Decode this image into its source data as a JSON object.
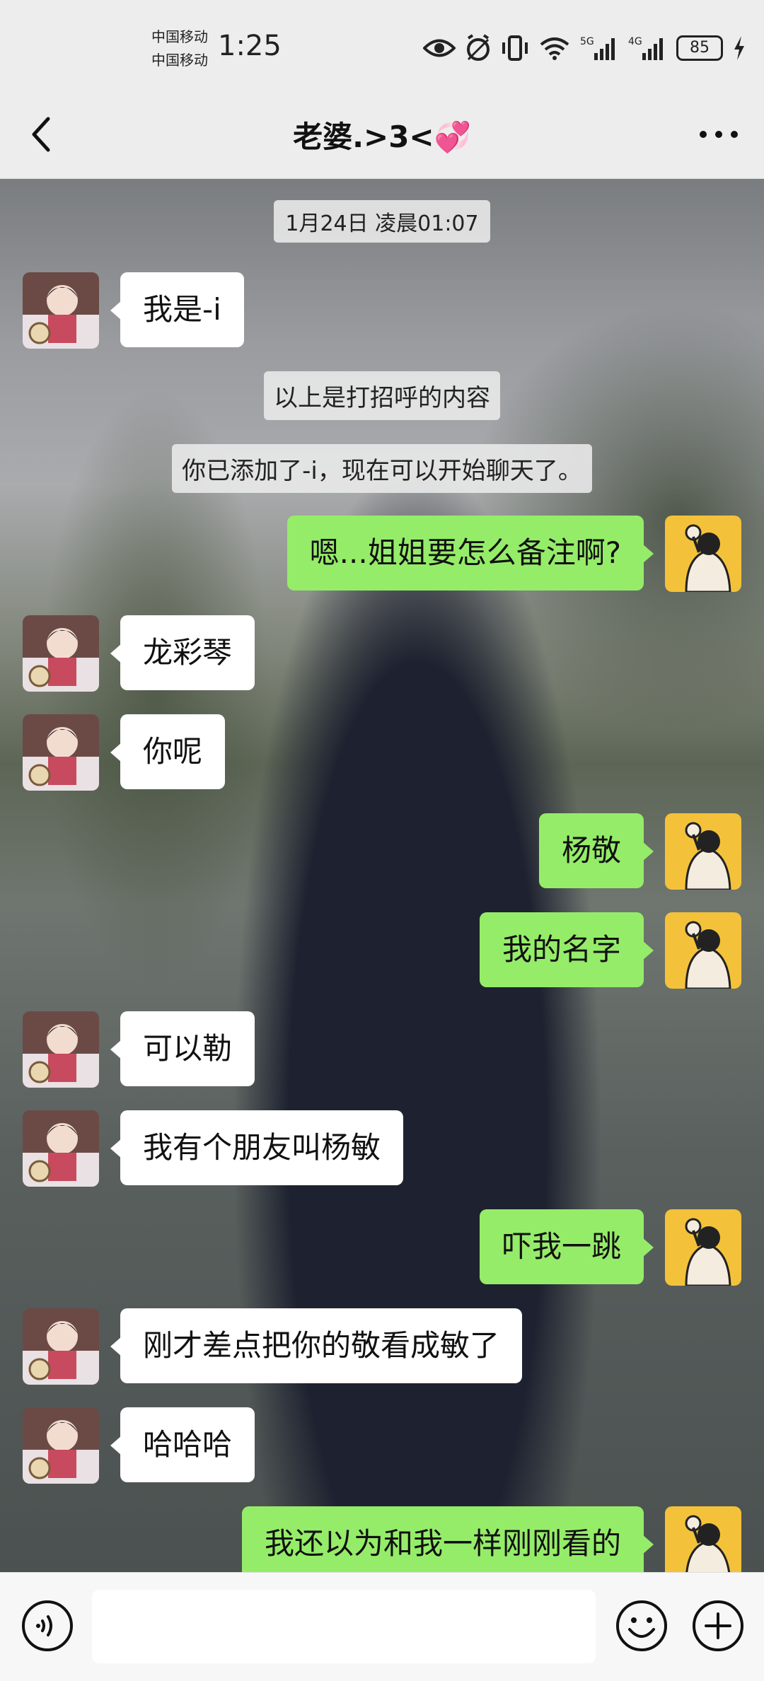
{
  "status_bar": {
    "carrier_1": "中国移动",
    "carrier_2": "中国移动",
    "time": "1:25",
    "network_1": "5G",
    "network_2": "4G",
    "battery": "85"
  },
  "header": {
    "title": "老婆.>3<💞"
  },
  "chat": {
    "timestamp": "1月24日 凌晨01:07",
    "system_messages": [
      "以上是打招呼的内容",
      "你已添加了-i，现在可以开始聊天了。"
    ],
    "messages": [
      {
        "side": "left",
        "text": "我是-i"
      },
      {
        "side": "right",
        "text": "嗯...姐姐要怎么备注啊?"
      },
      {
        "side": "left",
        "text": "龙彩琴"
      },
      {
        "side": "left",
        "text": "你呢"
      },
      {
        "side": "right",
        "text": "杨敬"
      },
      {
        "side": "right",
        "text": "我的名字"
      },
      {
        "side": "left",
        "text": "可以勒"
      },
      {
        "side": "left",
        "text": "我有个朋友叫杨敏"
      },
      {
        "side": "right",
        "text": "吓我一跳"
      },
      {
        "side": "left",
        "text": "刚才差点把你的敬看成敏了"
      },
      {
        "side": "left",
        "text": "哈哈哈"
      },
      {
        "side": "right",
        "text": "我还以为和我一样刚刚看的"
      }
    ]
  },
  "colors": {
    "sent_bubble": "#95ec69",
    "received_bubble": "#ffffff",
    "bar_background": "#ededed"
  },
  "icons": {
    "voice": "voice-icon",
    "emoji": "emoji-icon",
    "plus": "plus-icon"
  }
}
